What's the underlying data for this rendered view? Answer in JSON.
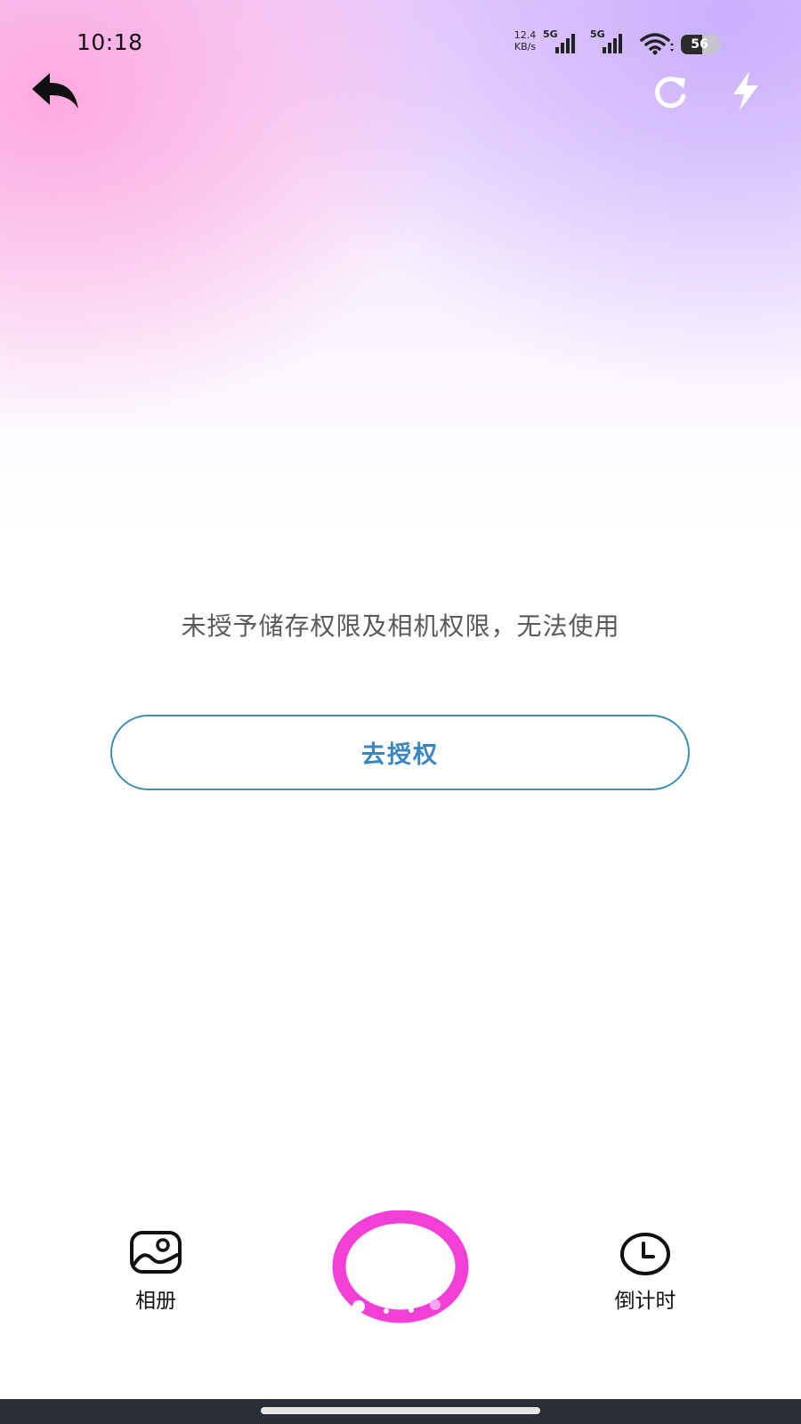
{
  "status_bar": {
    "time": "10:18",
    "net_speed_value": "12.4",
    "net_speed_unit": "KB/s",
    "sim1_type": "5G",
    "sim2_type": "5G",
    "battery_level": "56"
  },
  "top_bar": {
    "back_icon": "back-arrow-icon",
    "refresh_icon": "refresh-icon",
    "flash_icon": "flash-icon"
  },
  "main": {
    "permission_message": "未授予储存权限及相机权限，无法使用",
    "authorize_button_label": "去授权"
  },
  "bottom_bar": {
    "album_label": "相册",
    "timer_label": "倒计时",
    "shutter_color": "#f23fd6"
  },
  "colors": {
    "accent_blue": "#3a86c0",
    "button_border": "#3d8fb5",
    "nav_bar": "#2a2d35"
  }
}
